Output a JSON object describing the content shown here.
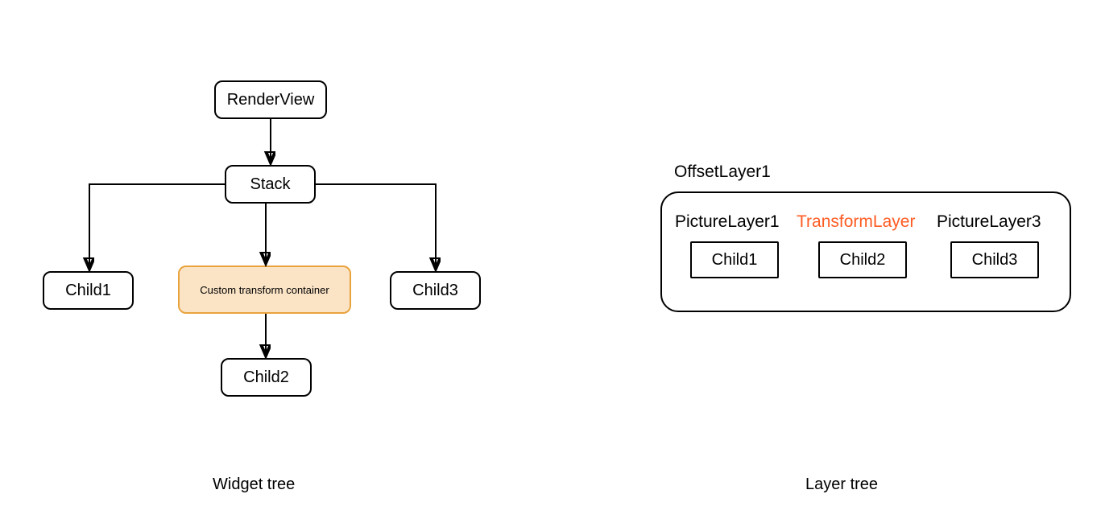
{
  "widgetTree": {
    "renderView": "RenderView",
    "stack": "Stack",
    "child1": "Child1",
    "transformContainer": "Custom transform container",
    "child3": "Child3",
    "child2": "Child2",
    "caption": "Widget tree"
  },
  "layerTree": {
    "offsetLayer": "OffsetLayer1",
    "pictureLayer1": "PictureLayer1",
    "transformLayer": "TransformLayer",
    "pictureLayer3": "PictureLayer3",
    "child1": "Child1",
    "child2": "Child2",
    "child3": "Child3",
    "caption": "Layer tree"
  },
  "colors": {
    "highlightFill": "#FBE4C6",
    "highlightBorder": "#E8A33D",
    "accentText": "#FF5B22"
  }
}
